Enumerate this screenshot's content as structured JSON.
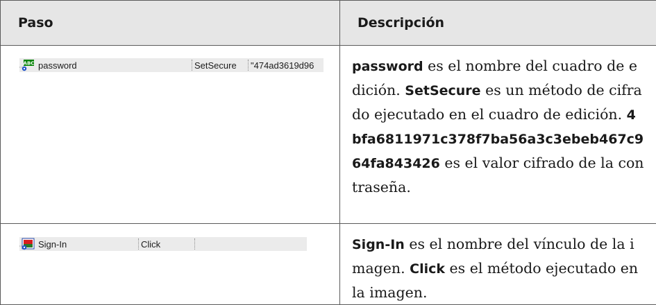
{
  "table": {
    "headers": {
      "step": "Paso",
      "description": "Descripción"
    },
    "rows": [
      {
        "object_name": "password",
        "method": "SetSecure",
        "argument": "\"474ad3619d96",
        "icon": "edit-box-icon",
        "icon_text": "ABC",
        "desc_name": "password",
        "desc_text_1": " es el nombre del cuadro de edición. ",
        "desc_method": "SetSecure",
        "desc_text_2": " es un método de cifrado ejecutado en el cuadro de edición. ",
        "desc_value": "4bfa6811971c378f7ba56a3c3ebeb467c964fa843426",
        "desc_text_3": " es el valor cifrado de la contraseña."
      },
      {
        "object_name": "Sign-In",
        "method": "Click",
        "argument": "",
        "icon": "image-link-icon",
        "desc_name": "Sign-In",
        "desc_text_1": " es el nombre del vínculo de la imagen. ",
        "desc_method": "Click",
        "desc_text_2": " es el método ejecutado en la imagen."
      }
    ]
  },
  "colors": {
    "header_bg": "#e6e6e6",
    "border": "#5a5a5a",
    "step_bar_bg": "#ebebeb"
  }
}
